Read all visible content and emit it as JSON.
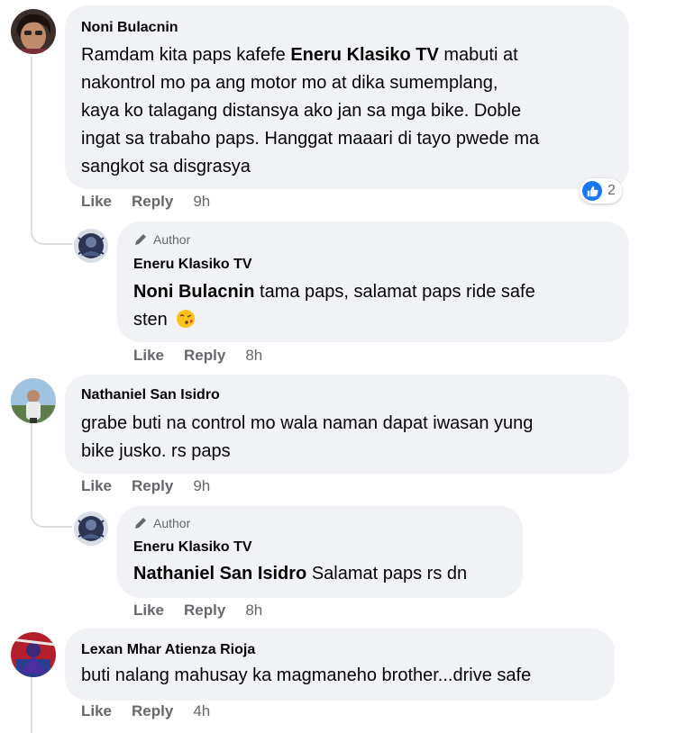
{
  "comments": [
    {
      "author": "Noni Bulacnin",
      "lines": [
        {
          "parts": [
            {
              "t": "Ramdam kita paps kafefe "
            },
            {
              "t": "Eneru Klasiko TV",
              "b": true
            },
            {
              "t": " mabuti at"
            }
          ]
        },
        {
          "parts": [
            {
              "t": "nakontrol mo pa ang motor mo at dika sumemplang,"
            }
          ]
        },
        {
          "parts": [
            {
              "t": "kaya ko talagang distansya ako jan sa mga bike. Doble"
            }
          ]
        },
        {
          "parts": [
            {
              "t": "ingat sa trabaho paps. Hanggat maaari di tayo pwede ma"
            }
          ]
        },
        {
          "parts": [
            {
              "t": "sangkot sa disgrasya"
            }
          ]
        }
      ],
      "like_label": "Like",
      "reply_label": "Reply",
      "time": "9h",
      "reaction_count": "2",
      "reaction_icon": "like-icon",
      "reply": {
        "badge": "Author",
        "author": "Eneru Klasiko TV",
        "mention": "Noni Bulacnin",
        "text_line1": " tama paps, salamat paps ride safe",
        "text_line2": "sten",
        "emoji": "face-blowing-kiss",
        "like_label": "Like",
        "reply_label": "Reply",
        "time": "8h"
      }
    },
    {
      "author": "Nathaniel San Isidro",
      "lines": [
        {
          "parts": [
            {
              "t": "grabe buti na control mo wala naman dapat iwasan yung"
            }
          ]
        },
        {
          "parts": [
            {
              "t": "bike jusko. rs paps"
            }
          ]
        }
      ],
      "like_label": "Like",
      "reply_label": "Reply",
      "time": "9h",
      "reply": {
        "badge": "Author",
        "author": "Eneru Klasiko TV",
        "mention": "Nathaniel San Isidro",
        "text_line1": " Salamat paps rs dn",
        "like_label": "Like",
        "reply_label": "Reply",
        "time": "8h"
      }
    },
    {
      "author": "Lexan Mhar Atienza Rioja",
      "lines": [
        {
          "parts": [
            {
              "t": "buti nalang mahusay ka magmaneho brother...drive safe"
            }
          ]
        }
      ],
      "like_label": "Like",
      "reply_label": "Reply",
      "time": "4h"
    }
  ],
  "colors": {
    "bubble": "#f0f2f5",
    "secondary_text": "#65676b",
    "like_blue": "#1877f2",
    "thread_line": "#dadde1"
  }
}
